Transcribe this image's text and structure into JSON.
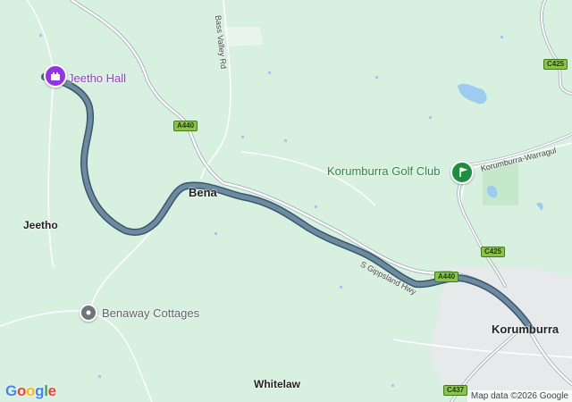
{
  "map": {
    "attribution": "Map data ©2026 Google",
    "logo_letters": [
      {
        "ch": "G",
        "color": "#4285F4"
      },
      {
        "ch": "o",
        "color": "#EA4335"
      },
      {
        "ch": "o",
        "color": "#FBBC05"
      },
      {
        "ch": "g",
        "color": "#4285F4"
      },
      {
        "ch": "l",
        "color": "#34A853"
      },
      {
        "ch": "e",
        "color": "#EA4335"
      }
    ]
  },
  "places": {
    "jeetho": "Jeetho",
    "bena": "Bena",
    "whitelaw": "Whitelaw",
    "korumburra": "Korumburra"
  },
  "pois": {
    "jeetho_hall": {
      "label": "Jeetho Hall",
      "icon": "castle-icon",
      "color": "#9334e6"
    },
    "golf_club": {
      "label": "Korumburra Golf Club",
      "icon": "golf-flag-icon",
      "color": "#1e8e3e"
    },
    "benaway": {
      "label": "Benaway Cottages",
      "icon": "place-marker-icon",
      "color": "#70757a"
    }
  },
  "roads": {
    "bass_valley_rd": "Bass Valley Rd",
    "s_gippsland_hwy": "S Gippsland Hwy",
    "korumburra_warragul": "Korumburra-Warragul"
  },
  "shields": {
    "a440_north": "A440",
    "a440_east": "A440",
    "c425_north": "C425",
    "c425_mid": "C425",
    "c437": "C437"
  },
  "colors": {
    "land": "#d7f0df",
    "route": "#5f7d96",
    "route_edge": "#3d5568",
    "road": "#ffffff",
    "urban": "#e8e8ec",
    "water": "#9ecbf0"
  }
}
